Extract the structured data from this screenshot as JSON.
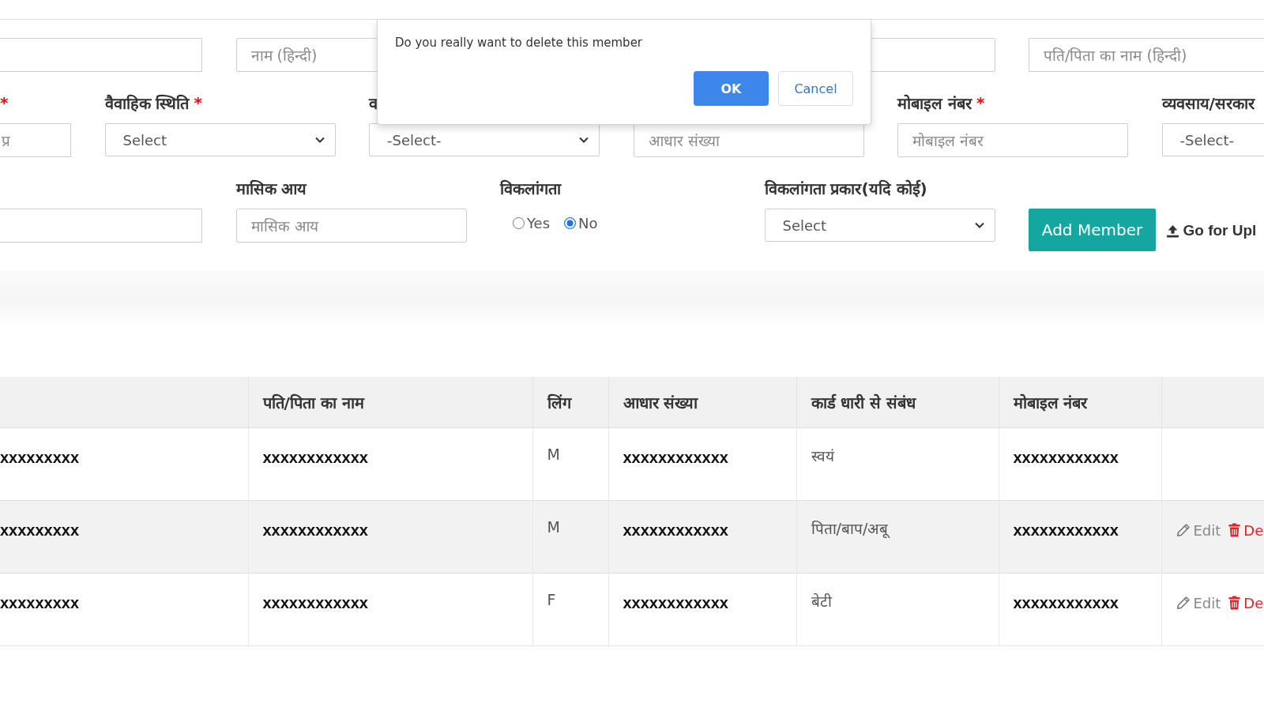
{
  "form": {
    "rows": [
      {
        "fields": [
          {
            "kind": "input"
          },
          {
            "kind": "input",
            "placeholder": "नाम (हिन्दी)"
          },
          {
            "kind": "input"
          },
          {
            "kind": "input",
            "placeholder": "पति/पिता का नाम (हिन्दी)"
          }
        ]
      },
      {
        "fields": [
          {
            "kind": "input",
            "required_mark": "*",
            "placeholder": "प्र"
          },
          {
            "kind": "select",
            "label": "वैवाहिक स्थिति",
            "required_mark": "*",
            "value": "Select",
            "chevron": true
          },
          {
            "kind": "select",
            "label": "व",
            "value": "-Select-",
            "chevron": true
          },
          {
            "kind": "input",
            "placeholder": "आधार संख्या"
          },
          {
            "kind": "input",
            "label": "मोबाइल नंबर",
            "required_mark": "*",
            "placeholder": "मोबाइल नंबर"
          },
          {
            "kind": "select",
            "label": "व्यवसाय/सरकार",
            "value": "-Select-",
            "chevron": false
          }
        ]
      },
      {
        "fields": [
          {
            "kind": "input"
          },
          {
            "kind": "input",
            "label": "मासिक आय",
            "placeholder": "मासिक आय"
          },
          {
            "kind": "radio",
            "label": "विकलांगता",
            "options": [
              {
                "label": "Yes",
                "selected": false
              },
              {
                "label": "No",
                "selected": true
              }
            ]
          },
          {
            "kind": "select",
            "label": "विकलांगता प्रकार(यदि कोई)",
            "value": "Select",
            "chevron": true
          },
          {
            "kind": "button",
            "text": "Add Member"
          },
          {
            "kind": "link",
            "text": "Go for Upl"
          }
        ]
      }
    ]
  },
  "dialog": {
    "message": "Do you really want to delete this member",
    "buttons": [
      {
        "label": "OK",
        "kind": "primary"
      },
      {
        "label": "Cancel",
        "kind": "secondary"
      }
    ]
  },
  "table": {
    "columns": [
      {},
      {
        "label": "पति/पिता का नाम"
      },
      {
        "label": "लिंग"
      },
      {
        "label": "आधार संख्या"
      },
      {
        "label": "कार्ड धारी से संबंध"
      },
      {
        "label": "मोबाइल नंबर"
      },
      {}
    ],
    "rows": [
      {
        "cells": [
          "xxxxxxxxx",
          "xxxxxxxxxxxx",
          "M",
          "xxxxxxxxxxxx",
          "स्वयं",
          "xxxxxxxxxxxx"
        ]
      },
      {
        "cells": [
          "xxxxxxxxx",
          "xxxxxxxxxxxx",
          "M",
          "xxxxxxxxxxxx",
          "पिता/बाप/अबू",
          "xxxxxxxxxxxx"
        ],
        "actions": [
          {
            "kind": "edit",
            "label": "Edit"
          },
          {
            "kind": "delete",
            "label": "De"
          }
        ]
      },
      {
        "cells": [
          "xxxxxxxxx",
          "xxxxxxxxxxxx",
          "F",
          "xxxxxxxxxxxx",
          "बेटी",
          "xxxxxxxxxxxx"
        ],
        "actions": [
          {
            "kind": "edit",
            "label": "Edit"
          },
          {
            "kind": "delete",
            "label": "De"
          }
        ]
      }
    ]
  }
}
